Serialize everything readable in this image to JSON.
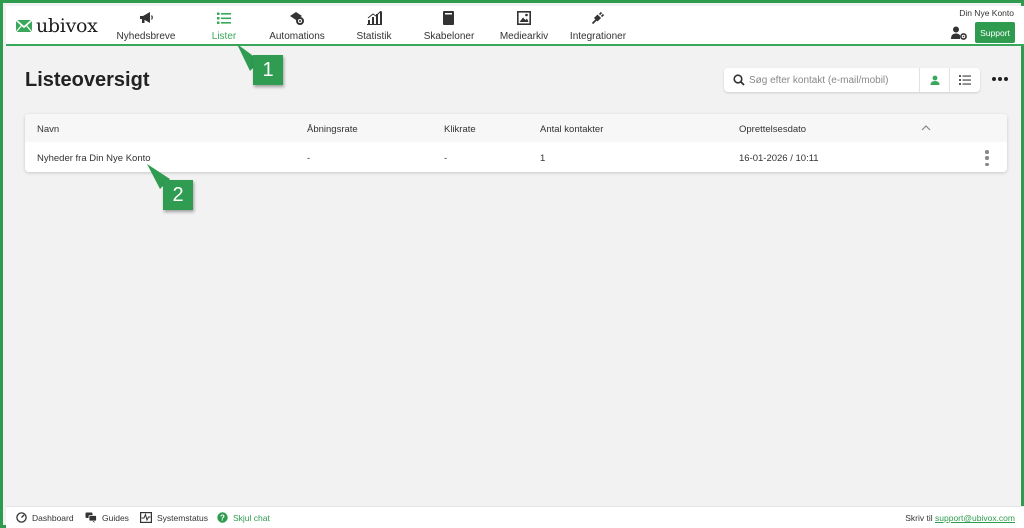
{
  "brand": {
    "name": "ubivox",
    "accent": "#2e9b4f"
  },
  "nav": {
    "items": [
      {
        "label": "Nyhedsbreve",
        "icon": "megaphone-icon"
      },
      {
        "label": "Lister",
        "icon": "list-icon",
        "active": true
      },
      {
        "label": "Automations",
        "icon": "automation-icon"
      },
      {
        "label": "Statistik",
        "icon": "chart-icon"
      },
      {
        "label": "Skabeloner",
        "icon": "template-icon"
      },
      {
        "label": "Mediearkiv",
        "icon": "image-icon"
      },
      {
        "label": "Integrationer",
        "icon": "plug-icon"
      }
    ],
    "account": "Din Nye Konto",
    "support_label": "Support"
  },
  "page": {
    "title": "Listeoversigt",
    "search_placeholder": "Søg efter kontakt (e-mail/mobil)"
  },
  "table": {
    "columns": [
      "Navn",
      "Åbningsrate",
      "Klikrate",
      "Antal kontakter",
      "Oprettelsesdato"
    ],
    "rows": [
      [
        "Nyheder fra Din Nye Konto",
        "-",
        "-",
        "1",
        "16-01-2026 / 10:11"
      ]
    ]
  },
  "callouts": [
    "1",
    "2"
  ],
  "footer": {
    "items": [
      {
        "label": "Dashboard",
        "icon": "gauge-icon"
      },
      {
        "label": "Guides",
        "icon": "chat-icon"
      },
      {
        "label": "Systemstatus",
        "icon": "pulse-icon"
      },
      {
        "label": "Skjul chat",
        "icon": "help-circle-icon"
      }
    ],
    "contact_prefix": "Skriv til",
    "contact_email": "support@ubivox.com"
  }
}
